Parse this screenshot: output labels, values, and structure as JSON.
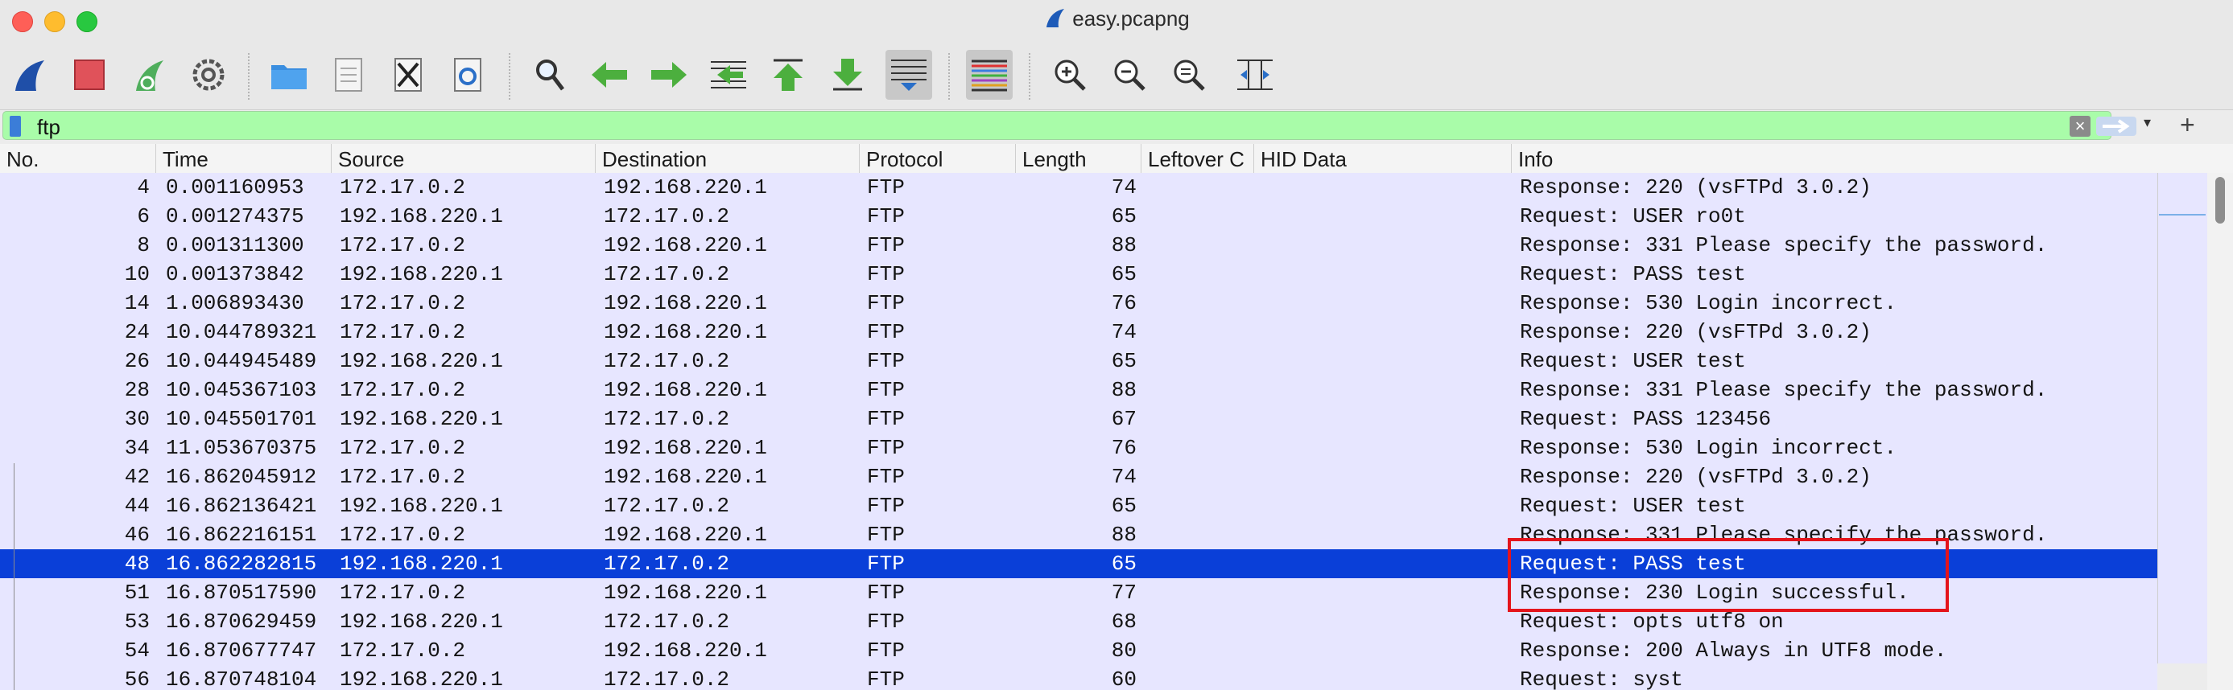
{
  "window": {
    "title": "easy.pcapng"
  },
  "filter": {
    "value": "ftp"
  },
  "columns": [
    "No.",
    "Time",
    "Source",
    "Destination",
    "Protocol",
    "Length",
    "Leftover C",
    "HID Data",
    "Info"
  ],
  "packets": [
    {
      "no": "4",
      "time": "0.001160953",
      "src": "172.17.0.2",
      "dst": "192.168.220.1",
      "proto": "FTP",
      "len": "74",
      "info": "Response: 220 (vsFTPd 3.0.2)"
    },
    {
      "no": "6",
      "time": "0.001274375",
      "src": "192.168.220.1",
      "dst": "172.17.0.2",
      "proto": "FTP",
      "len": "65",
      "info": "Request: USER ro0t"
    },
    {
      "no": "8",
      "time": "0.001311300",
      "src": "172.17.0.2",
      "dst": "192.168.220.1",
      "proto": "FTP",
      "len": "88",
      "info": "Response: 331 Please specify the password."
    },
    {
      "no": "10",
      "time": "0.001373842",
      "src": "192.168.220.1",
      "dst": "172.17.0.2",
      "proto": "FTP",
      "len": "65",
      "info": "Request: PASS test"
    },
    {
      "no": "14",
      "time": "1.006893430",
      "src": "172.17.0.2",
      "dst": "192.168.220.1",
      "proto": "FTP",
      "len": "76",
      "info": "Response: 530 Login incorrect."
    },
    {
      "no": "24",
      "time": "10.044789321",
      "src": "172.17.0.2",
      "dst": "192.168.220.1",
      "proto": "FTP",
      "len": "74",
      "info": "Response: 220 (vsFTPd 3.0.2)"
    },
    {
      "no": "26",
      "time": "10.044945489",
      "src": "192.168.220.1",
      "dst": "172.17.0.2",
      "proto": "FTP",
      "len": "65",
      "info": "Request: USER test"
    },
    {
      "no": "28",
      "time": "10.045367103",
      "src": "172.17.0.2",
      "dst": "192.168.220.1",
      "proto": "FTP",
      "len": "88",
      "info": "Response: 331 Please specify the password."
    },
    {
      "no": "30",
      "time": "10.045501701",
      "src": "192.168.220.1",
      "dst": "172.17.0.2",
      "proto": "FTP",
      "len": "67",
      "info": "Request: PASS 123456"
    },
    {
      "no": "34",
      "time": "11.053670375",
      "src": "172.17.0.2",
      "dst": "192.168.220.1",
      "proto": "FTP",
      "len": "76",
      "info": "Response: 530 Login incorrect."
    },
    {
      "no": "42",
      "time": "16.862045912",
      "src": "172.17.0.2",
      "dst": "192.168.220.1",
      "proto": "FTP",
      "len": "74",
      "info": "Response: 220 (vsFTPd 3.0.2)"
    },
    {
      "no": "44",
      "time": "16.862136421",
      "src": "192.168.220.1",
      "dst": "172.17.0.2",
      "proto": "FTP",
      "len": "65",
      "info": "Request: USER test"
    },
    {
      "no": "46",
      "time": "16.862216151",
      "src": "172.17.0.2",
      "dst": "192.168.220.1",
      "proto": "FTP",
      "len": "88",
      "info": "Response: 331 Please specify the password."
    },
    {
      "no": "48",
      "time": "16.862282815",
      "src": "192.168.220.1",
      "dst": "172.17.0.2",
      "proto": "FTP",
      "len": "65",
      "info": "Request: PASS test",
      "selected": true
    },
    {
      "no": "51",
      "time": "16.870517590",
      "src": "172.17.0.2",
      "dst": "192.168.220.1",
      "proto": "FTP",
      "len": "77",
      "info": "Response: 230 Login successful."
    },
    {
      "no": "53",
      "time": "16.870629459",
      "src": "192.168.220.1",
      "dst": "172.17.0.2",
      "proto": "FTP",
      "len": "68",
      "info": "Request: opts utf8 on"
    },
    {
      "no": "54",
      "time": "16.870677747",
      "src": "172.17.0.2",
      "dst": "192.168.220.1",
      "proto": "FTP",
      "len": "80",
      "info": "Response: 200 Always in UTF8 mode."
    },
    {
      "no": "56",
      "time": "16.870748104",
      "src": "192.168.220.1",
      "dst": "172.17.0.2",
      "proto": "FTP",
      "len": "60",
      "info": "Request: syst"
    }
  ],
  "icons": [
    "shark-fin-start-icon",
    "stop-capture-icon",
    "restart-capture-icon",
    "capture-options-icon",
    "open-file-icon",
    "save-file-icon",
    "close-file-icon",
    "reload-file-icon",
    "find-packet-icon",
    "go-back-icon",
    "go-forward-icon",
    "go-to-packet-icon",
    "go-first-packet-icon",
    "go-last-packet-icon",
    "autoscroll-icon",
    "colorize-icon",
    "zoom-in-icon",
    "zoom-out-icon",
    "normal-size-icon",
    "resize-columns-icon"
  ],
  "colors": {
    "row_bg": "#e7e6ff",
    "selected_bg": "#0a3fd8",
    "filter_bg": "#a9fca9",
    "annotation": "#e4141c"
  }
}
